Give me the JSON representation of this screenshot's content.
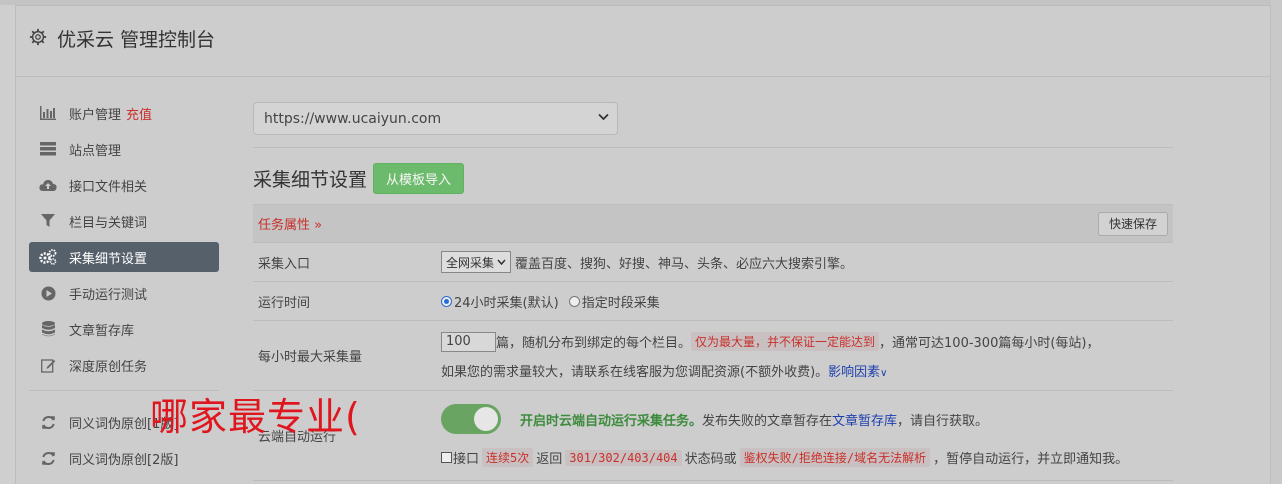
{
  "header": {
    "title": "优采云 管理控制台"
  },
  "sidebar": {
    "items": [
      {
        "label": "账户管理",
        "extra": "充值",
        "icon": "bar-chart-icon"
      },
      {
        "label": "站点管理",
        "icon": "server-icon"
      },
      {
        "label": "接口文件相关",
        "icon": "cloud-upload-icon"
      },
      {
        "label": "栏目与关键词",
        "icon": "filter-icon"
      },
      {
        "label": "采集细节设置",
        "icon": "cogs-icon",
        "active": true
      },
      {
        "label": "手动运行测试",
        "icon": "play-circle-icon"
      },
      {
        "label": "文章暂存库",
        "icon": "database-icon"
      },
      {
        "label": "深度原创任务",
        "icon": "edit-icon"
      }
    ],
    "items2": [
      {
        "label": "同义词伪原创[1版]",
        "icon": "refresh-icon"
      },
      {
        "label": "同义词伪原创[2版]",
        "icon": "refresh-icon"
      }
    ]
  },
  "main": {
    "site_select": "https://www.ucaiyun.com",
    "section_title": "采集细节设置",
    "import_btn": "从模板导入",
    "task_attr": "任务属性",
    "save_btn": "快速保存",
    "rows": {
      "entry": {
        "label": "采集入口",
        "select": "全网采集",
        "desc": "覆盖百度、搜狗、好搜、神马、头条、必应六大搜索引擎。"
      },
      "time": {
        "label": "运行时间",
        "opt1": "24小时采集(默认)",
        "opt2": "指定时段采集"
      },
      "max": {
        "label": "每小时最大采集量",
        "value": "100",
        "t1": "篇，随机分布到绑定的每个栏目。",
        "tag": "仅为最大量，并不保证一定能达到",
        "t2": "，通常可达100-300篇每小时(每站)，",
        "t3": "如果您的需求量较大，请联系在线客服为您调配资源(不额外收费)。",
        "link": "影响因素"
      },
      "cloud": {
        "label": "云端自动运行",
        "green": "开启时云端自动运行采集任务。",
        "t1": "发布失败的文章暂存在",
        "link": "文章暂存库",
        "t2": "，请自行获取。",
        "cb": "接口",
        "tag1": "连续5次",
        "t3": "返回",
        "tag2": "301/302/403/404",
        "t4": "状态码或",
        "tag3": "鉴权失败/拒绝连接/域名无法解析",
        "t5": "，暂停自动运行，并立即通知我。"
      }
    }
  },
  "watermark": "哪家最专业("
}
